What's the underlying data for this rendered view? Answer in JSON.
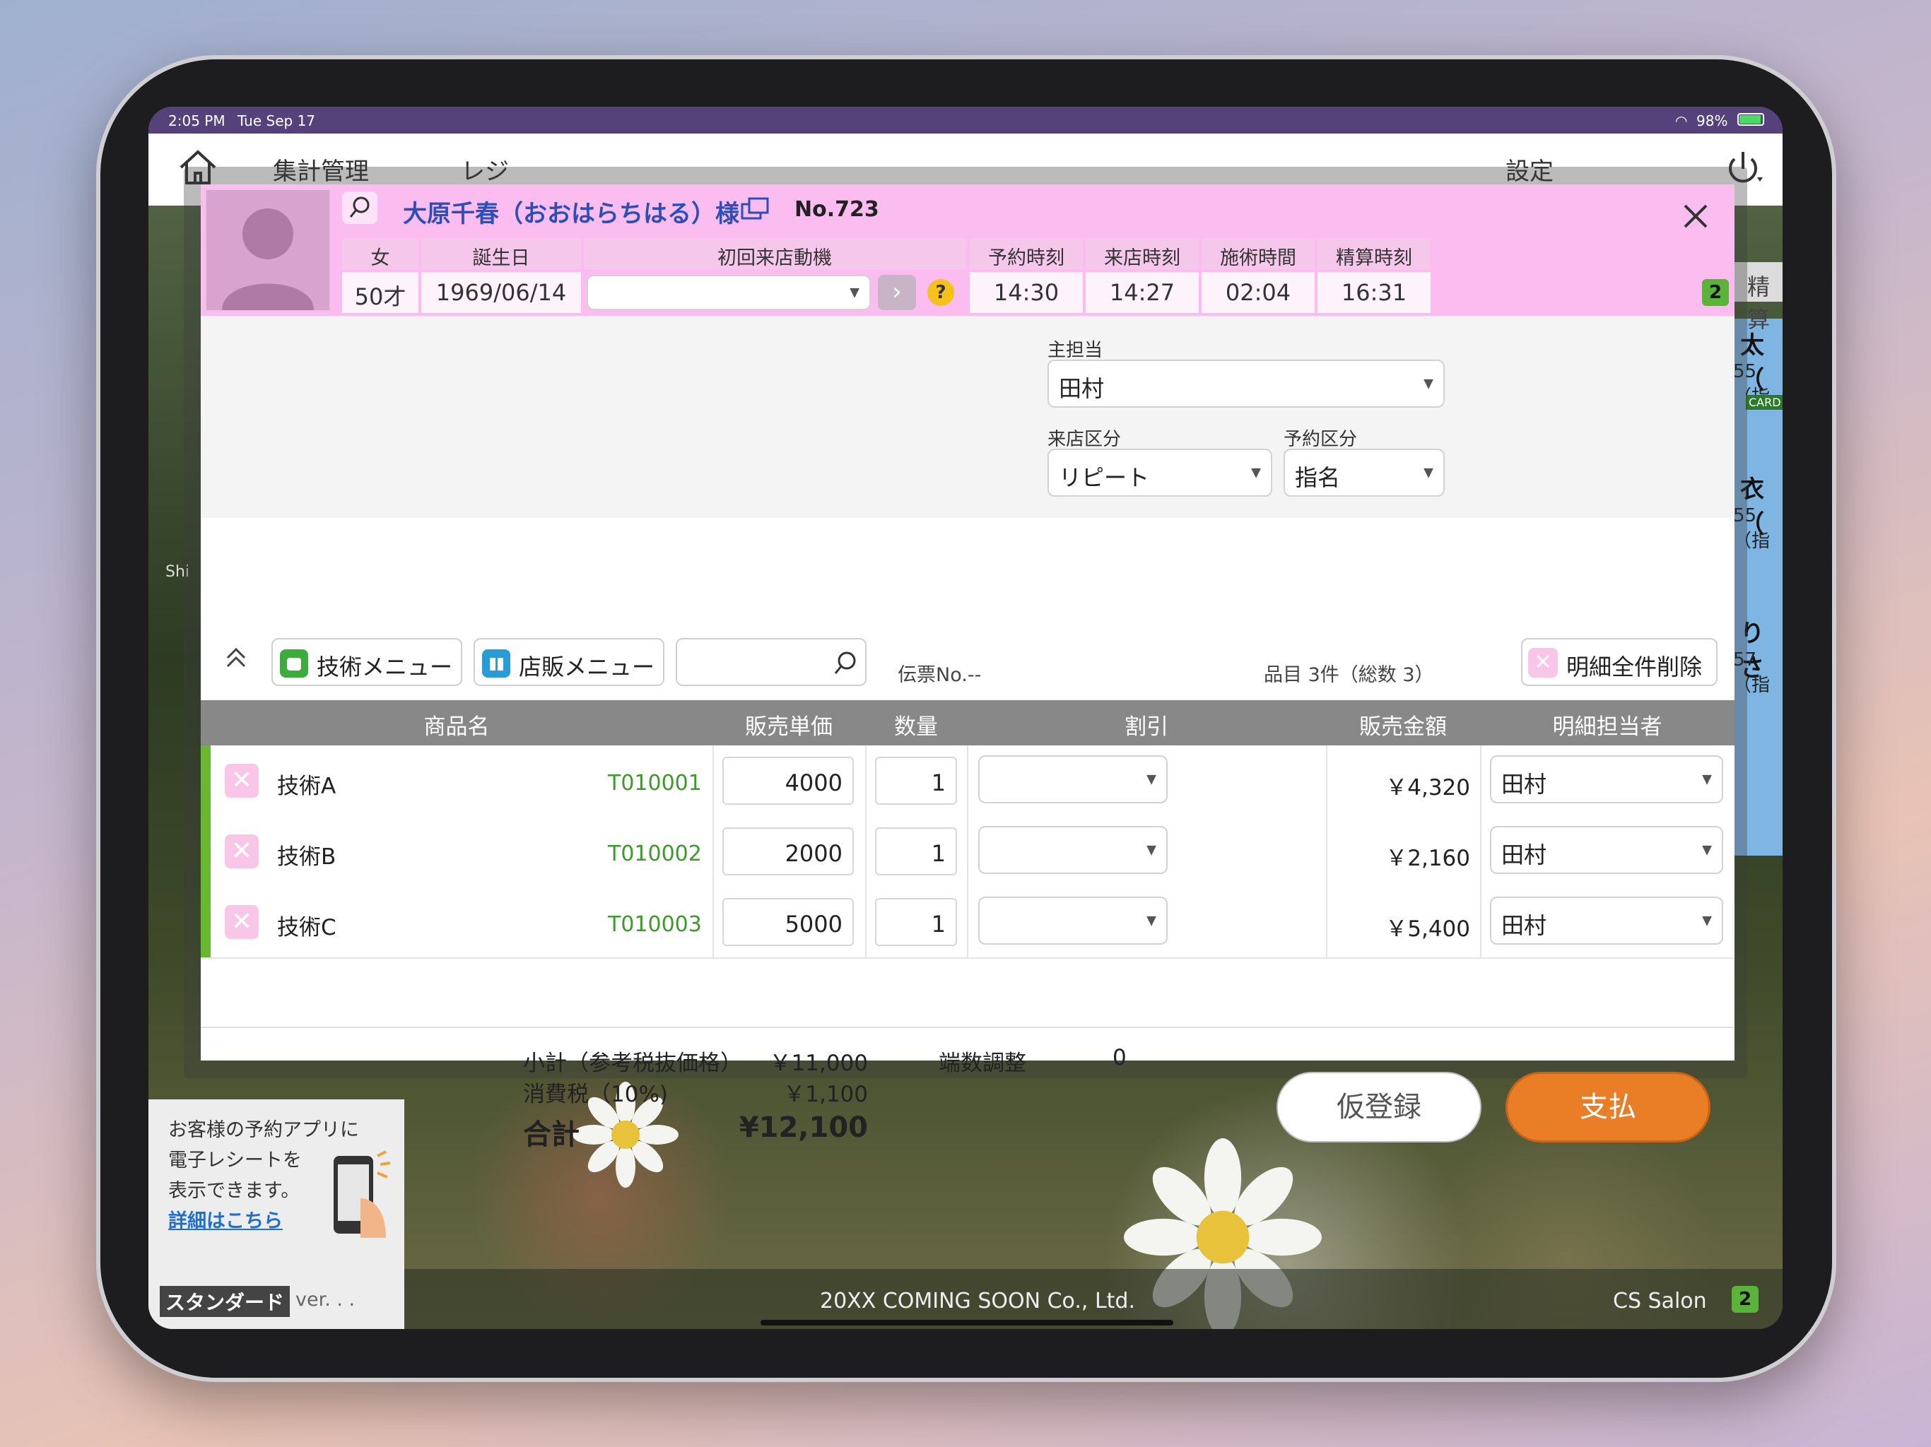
{
  "status_bar": {
    "time": "2:05 PM",
    "date": "Tue Sep 17",
    "battery": "98%"
  },
  "app_header": {
    "nav_items": [
      "集計管理",
      "レジ"
    ],
    "settings_label": "設定"
  },
  "customer": {
    "name": "大原千春（おおはらちはる）様",
    "number": "No.723",
    "gender_header": "女",
    "birthday_header": "誕生日",
    "motive_header": "初回来店動機",
    "age": "50才",
    "birthday": "1969/06/14",
    "motive_value": "",
    "help_mark": "?",
    "badge_count": "2"
  },
  "times": {
    "headers": [
      "予約時刻",
      "来店時刻",
      "施術時間",
      "精算時刻"
    ],
    "values": [
      "14:30",
      "14:27",
      "02:04",
      "16:31"
    ]
  },
  "staff": {
    "main_label": "主担当",
    "main_value": "田村",
    "visit_type_label": "来店区分",
    "visit_type_value": "リピート",
    "reservation_type_label": "予約区分",
    "reservation_type_value": "指名"
  },
  "toolbar": {
    "tech_menu_label": "技術メニュー",
    "retail_menu_label": "店販メニュー",
    "search_placeholder": "",
    "slip_no": "伝票No.--",
    "item_count": "品目 3件（総数 3）",
    "delete_all_label": "明細全件削除"
  },
  "table": {
    "headers": [
      "商品名",
      "販売単価",
      "数量",
      "割引",
      "販売金額",
      "明細担当者"
    ],
    "rows": [
      {
        "name": "技術A",
        "code": "T010001",
        "price": "4000",
        "qty": "1",
        "discount": "",
        "amount": "￥4,320",
        "staff": "田村"
      },
      {
        "name": "技術B",
        "code": "T010002",
        "price": "2000",
        "qty": "1",
        "discount": "",
        "amount": "￥2,160",
        "staff": "田村"
      },
      {
        "name": "技術C",
        "code": "T010003",
        "price": "5000",
        "qty": "1",
        "discount": "",
        "amount": "￥5,400",
        "staff": "田村"
      }
    ]
  },
  "totals": {
    "subtotal_label": "小計（参考税抜価格）",
    "subtotal_value": "￥11,000",
    "tax_label": "消費税（10%)",
    "tax_value": "￥1,100",
    "total_label": "合計",
    "total_value": "¥12,100",
    "rounding_label": "端数調整",
    "rounding_value": "0"
  },
  "actions": {
    "provisional_label": "仮登録",
    "pay_label": "支払"
  },
  "background_list": {
    "header_label": "精算",
    "entries": [
      {
        "name": "太（",
        "sub": "55（指"
      },
      {
        "name": "衣（",
        "sub": "55（指"
      },
      {
        "name": "りさ",
        "sub": "57（指"
      }
    ],
    "card_label": "CARD",
    "left_fragment": "Shi"
  },
  "promo": {
    "lines": [
      "お客様の予約アプリに",
      "電子レシートを",
      "表示できます。"
    ],
    "link_label": "詳細はこちら"
  },
  "bottom_bar": {
    "plan_label": "スタンダード",
    "version_label": "ver. . .",
    "copyright": "20XX COMING SOON Co., Ltd.",
    "salon_name": "CS Salon",
    "badge_count": "2"
  },
  "colors": {
    "accent_pink": "#fbbcf0",
    "pay_orange": "#e97e26",
    "status_purple": "#56427a",
    "code_green": "#3e9a2c",
    "name_blue": "#2d4fb5"
  }
}
